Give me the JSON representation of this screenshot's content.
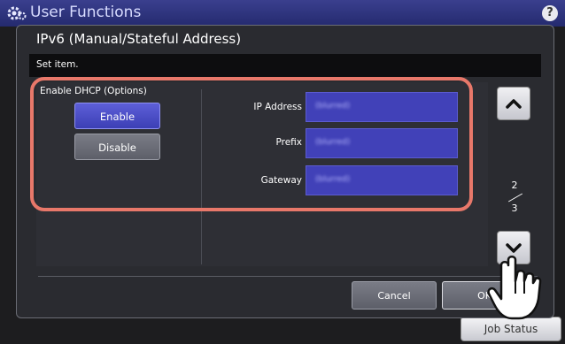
{
  "app": {
    "title": "User Functions",
    "help_icon": "?"
  },
  "dialog": {
    "title": "IPv6 (Manual/Stateful Address)",
    "message": "Set item.",
    "dhcp": {
      "label": "Enable DHCP (Options)",
      "enable_label": "Enable",
      "disable_label": "Disable"
    },
    "fields": [
      {
        "label": "IP Address",
        "value": "(blurred)"
      },
      {
        "label": "Prefix",
        "value": "(blurred)"
      },
      {
        "label": "Gateway",
        "value": "(blurred)"
      }
    ],
    "pager": {
      "current": "2",
      "total": "3"
    },
    "cancel_label": "Cancel",
    "ok_label": "OK"
  },
  "footer": {
    "job_status_label": "Job Status"
  },
  "colors": {
    "accent": "#4141b8",
    "highlight": "#e8786a",
    "header": "#2f3580"
  }
}
